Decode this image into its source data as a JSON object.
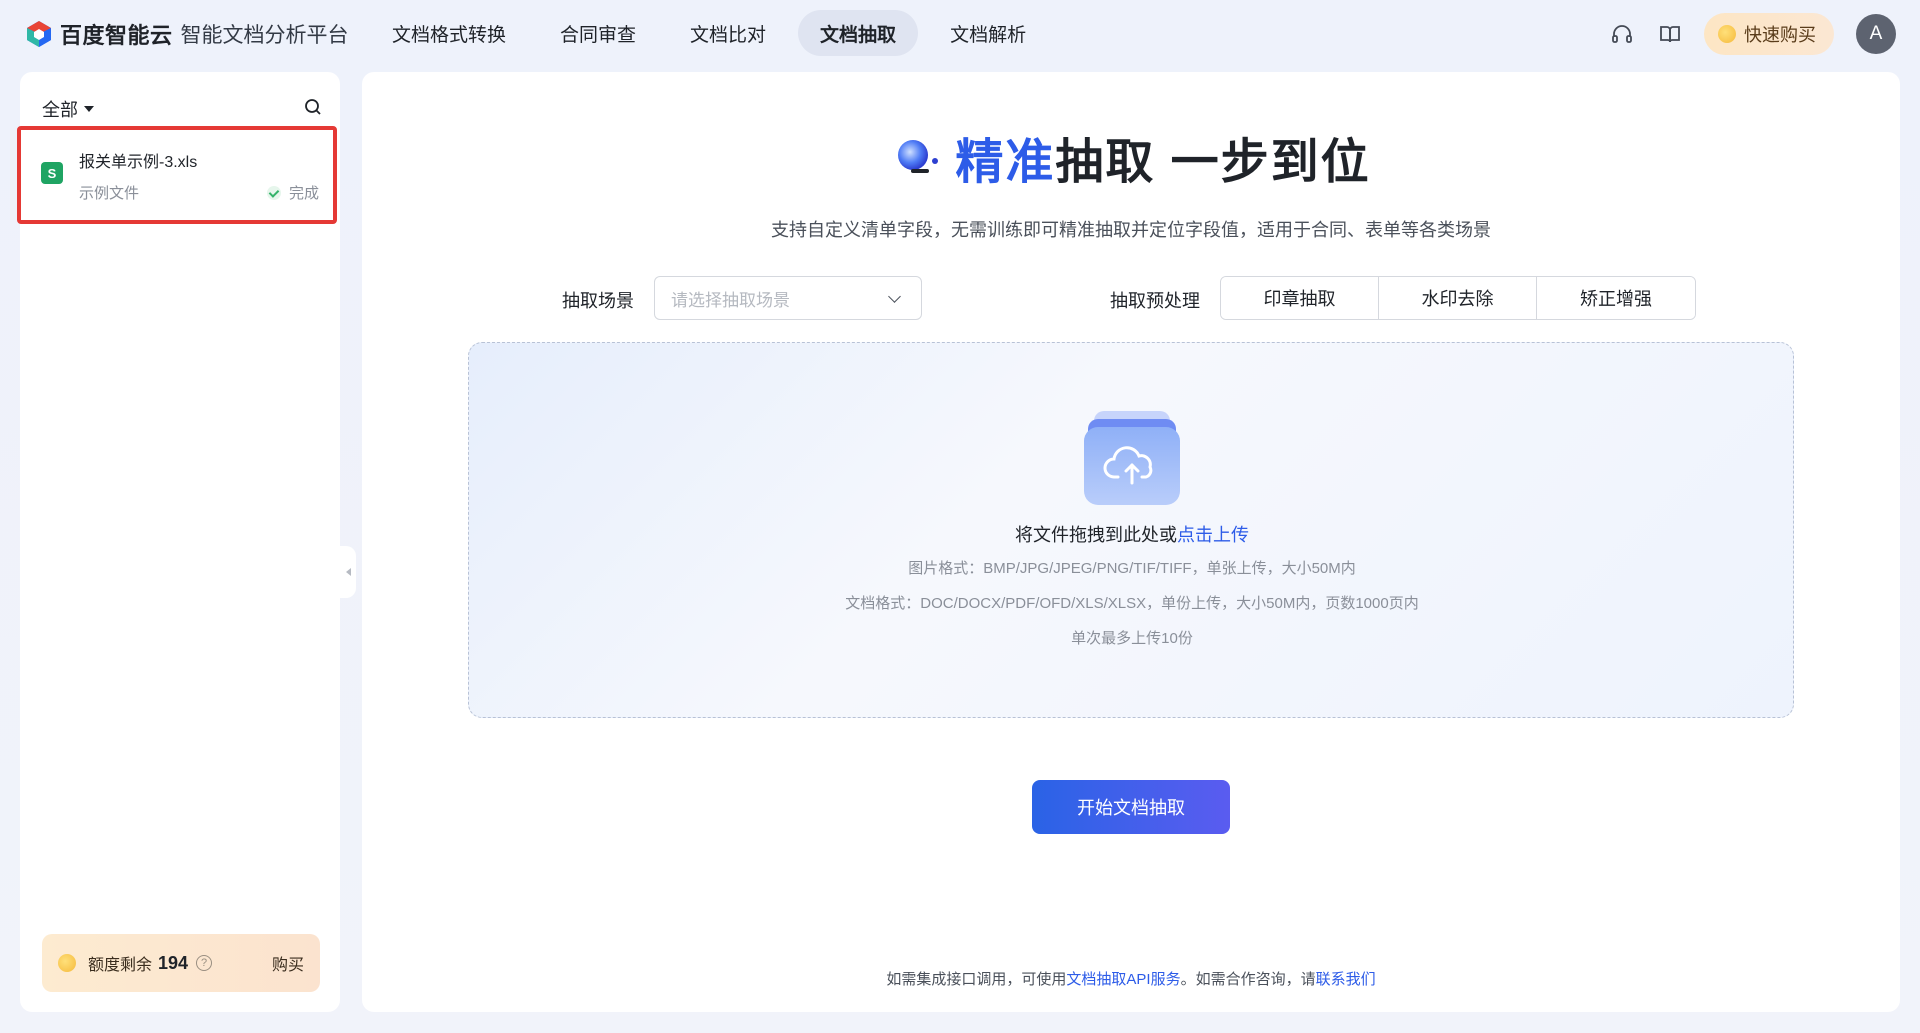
{
  "header": {
    "brand": "百度智能云",
    "product": "智能文档分析平台",
    "nav": [
      {
        "label": "文档格式转换",
        "active": false
      },
      {
        "label": "合同审查",
        "active": false
      },
      {
        "label": "文档比对",
        "active": false
      },
      {
        "label": "文档抽取",
        "active": true
      },
      {
        "label": "文档解析",
        "active": false
      }
    ],
    "support_icon": "headset-icon",
    "docs_icon": "book-icon",
    "quick_buy": "快速购买",
    "avatar_initial": "A"
  },
  "sidebar": {
    "filter_label": "全部",
    "search_icon": "search-icon",
    "file": {
      "icon_letter": "S",
      "name": "报关单示例-3.xls",
      "tag": "示例文件",
      "status": "完成"
    },
    "quota": {
      "label": "额度剩余",
      "value": "194",
      "help": "?",
      "buy": "购买"
    }
  },
  "main": {
    "hero": {
      "title_accent": "精准",
      "title_rest": "抽取 一步到位"
    },
    "subtitle": "支持自定义清单字段，无需训练即可精准抽取并定位字段值，适用于合同、表单等各类场景",
    "scene_label": "抽取场景",
    "scene_placeholder": "请选择抽取场景",
    "preprocess_label": "抽取预处理",
    "preprocess_options": [
      "印章抽取",
      "水印去除",
      "矫正增强"
    ],
    "upload": {
      "prompt": "将文件拖拽到此处或",
      "link": "点击上传",
      "image_formats": "图片格式：BMP/JPG/JPEG/PNG/TIF/TIFF，单张上传，大小50M内",
      "doc_formats": "文档格式：DOC/DOCX/PDF/OFD/XLS/XLSX，单份上传，大小50M内，页数1000页内",
      "limit": "单次最多上传10份"
    },
    "start_button": "开始文档抽取",
    "footer": {
      "prefix": "如需集成接口调用，可使用",
      "api_link": "文档抽取API服务",
      "middle": "。如需合作咨询，请",
      "contact_link": "联系我们"
    }
  },
  "colors": {
    "accent": "#2d5ce8",
    "highlight_border": "#e53935",
    "success": "#34b36a"
  }
}
